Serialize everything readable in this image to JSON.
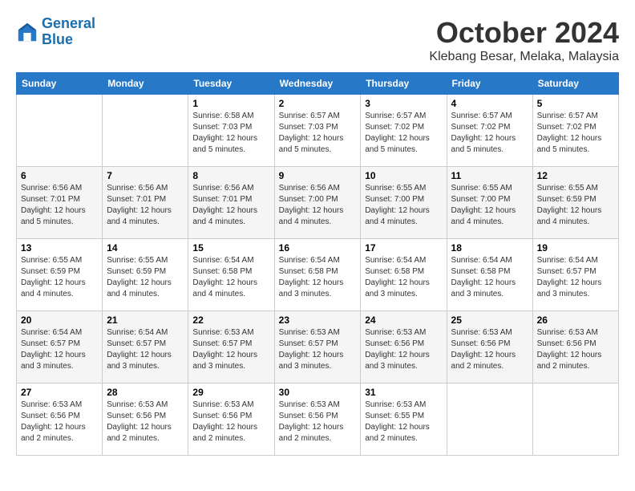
{
  "logo": {
    "line1": "General",
    "line2": "Blue"
  },
  "title": "October 2024",
  "location": "Klebang Besar, Melaka, Malaysia",
  "headers": [
    "Sunday",
    "Monday",
    "Tuesday",
    "Wednesday",
    "Thursday",
    "Friday",
    "Saturday"
  ],
  "weeks": [
    [
      {
        "day": "",
        "info": ""
      },
      {
        "day": "",
        "info": ""
      },
      {
        "day": "1",
        "info": "Sunrise: 6:58 AM\nSunset: 7:03 PM\nDaylight: 12 hours\nand 5 minutes."
      },
      {
        "day": "2",
        "info": "Sunrise: 6:57 AM\nSunset: 7:03 PM\nDaylight: 12 hours\nand 5 minutes."
      },
      {
        "day": "3",
        "info": "Sunrise: 6:57 AM\nSunset: 7:02 PM\nDaylight: 12 hours\nand 5 minutes."
      },
      {
        "day": "4",
        "info": "Sunrise: 6:57 AM\nSunset: 7:02 PM\nDaylight: 12 hours\nand 5 minutes."
      },
      {
        "day": "5",
        "info": "Sunrise: 6:57 AM\nSunset: 7:02 PM\nDaylight: 12 hours\nand 5 minutes."
      }
    ],
    [
      {
        "day": "6",
        "info": "Sunrise: 6:56 AM\nSunset: 7:01 PM\nDaylight: 12 hours\nand 5 minutes."
      },
      {
        "day": "7",
        "info": "Sunrise: 6:56 AM\nSunset: 7:01 PM\nDaylight: 12 hours\nand 4 minutes."
      },
      {
        "day": "8",
        "info": "Sunrise: 6:56 AM\nSunset: 7:01 PM\nDaylight: 12 hours\nand 4 minutes."
      },
      {
        "day": "9",
        "info": "Sunrise: 6:56 AM\nSunset: 7:00 PM\nDaylight: 12 hours\nand 4 minutes."
      },
      {
        "day": "10",
        "info": "Sunrise: 6:55 AM\nSunset: 7:00 PM\nDaylight: 12 hours\nand 4 minutes."
      },
      {
        "day": "11",
        "info": "Sunrise: 6:55 AM\nSunset: 7:00 PM\nDaylight: 12 hours\nand 4 minutes."
      },
      {
        "day": "12",
        "info": "Sunrise: 6:55 AM\nSunset: 6:59 PM\nDaylight: 12 hours\nand 4 minutes."
      }
    ],
    [
      {
        "day": "13",
        "info": "Sunrise: 6:55 AM\nSunset: 6:59 PM\nDaylight: 12 hours\nand 4 minutes."
      },
      {
        "day": "14",
        "info": "Sunrise: 6:55 AM\nSunset: 6:59 PM\nDaylight: 12 hours\nand 4 minutes."
      },
      {
        "day": "15",
        "info": "Sunrise: 6:54 AM\nSunset: 6:58 PM\nDaylight: 12 hours\nand 4 minutes."
      },
      {
        "day": "16",
        "info": "Sunrise: 6:54 AM\nSunset: 6:58 PM\nDaylight: 12 hours\nand 3 minutes."
      },
      {
        "day": "17",
        "info": "Sunrise: 6:54 AM\nSunset: 6:58 PM\nDaylight: 12 hours\nand 3 minutes."
      },
      {
        "day": "18",
        "info": "Sunrise: 6:54 AM\nSunset: 6:58 PM\nDaylight: 12 hours\nand 3 minutes."
      },
      {
        "day": "19",
        "info": "Sunrise: 6:54 AM\nSunset: 6:57 PM\nDaylight: 12 hours\nand 3 minutes."
      }
    ],
    [
      {
        "day": "20",
        "info": "Sunrise: 6:54 AM\nSunset: 6:57 PM\nDaylight: 12 hours\nand 3 minutes."
      },
      {
        "day": "21",
        "info": "Sunrise: 6:54 AM\nSunset: 6:57 PM\nDaylight: 12 hours\nand 3 minutes."
      },
      {
        "day": "22",
        "info": "Sunrise: 6:53 AM\nSunset: 6:57 PM\nDaylight: 12 hours\nand 3 minutes."
      },
      {
        "day": "23",
        "info": "Sunrise: 6:53 AM\nSunset: 6:57 PM\nDaylight: 12 hours\nand 3 minutes."
      },
      {
        "day": "24",
        "info": "Sunrise: 6:53 AM\nSunset: 6:56 PM\nDaylight: 12 hours\nand 3 minutes."
      },
      {
        "day": "25",
        "info": "Sunrise: 6:53 AM\nSunset: 6:56 PM\nDaylight: 12 hours\nand 2 minutes."
      },
      {
        "day": "26",
        "info": "Sunrise: 6:53 AM\nSunset: 6:56 PM\nDaylight: 12 hours\nand 2 minutes."
      }
    ],
    [
      {
        "day": "27",
        "info": "Sunrise: 6:53 AM\nSunset: 6:56 PM\nDaylight: 12 hours\nand 2 minutes."
      },
      {
        "day": "28",
        "info": "Sunrise: 6:53 AM\nSunset: 6:56 PM\nDaylight: 12 hours\nand 2 minutes."
      },
      {
        "day": "29",
        "info": "Sunrise: 6:53 AM\nSunset: 6:56 PM\nDaylight: 12 hours\nand 2 minutes."
      },
      {
        "day": "30",
        "info": "Sunrise: 6:53 AM\nSunset: 6:56 PM\nDaylight: 12 hours\nand 2 minutes."
      },
      {
        "day": "31",
        "info": "Sunrise: 6:53 AM\nSunset: 6:55 PM\nDaylight: 12 hours\nand 2 minutes."
      },
      {
        "day": "",
        "info": ""
      },
      {
        "day": "",
        "info": ""
      }
    ]
  ]
}
